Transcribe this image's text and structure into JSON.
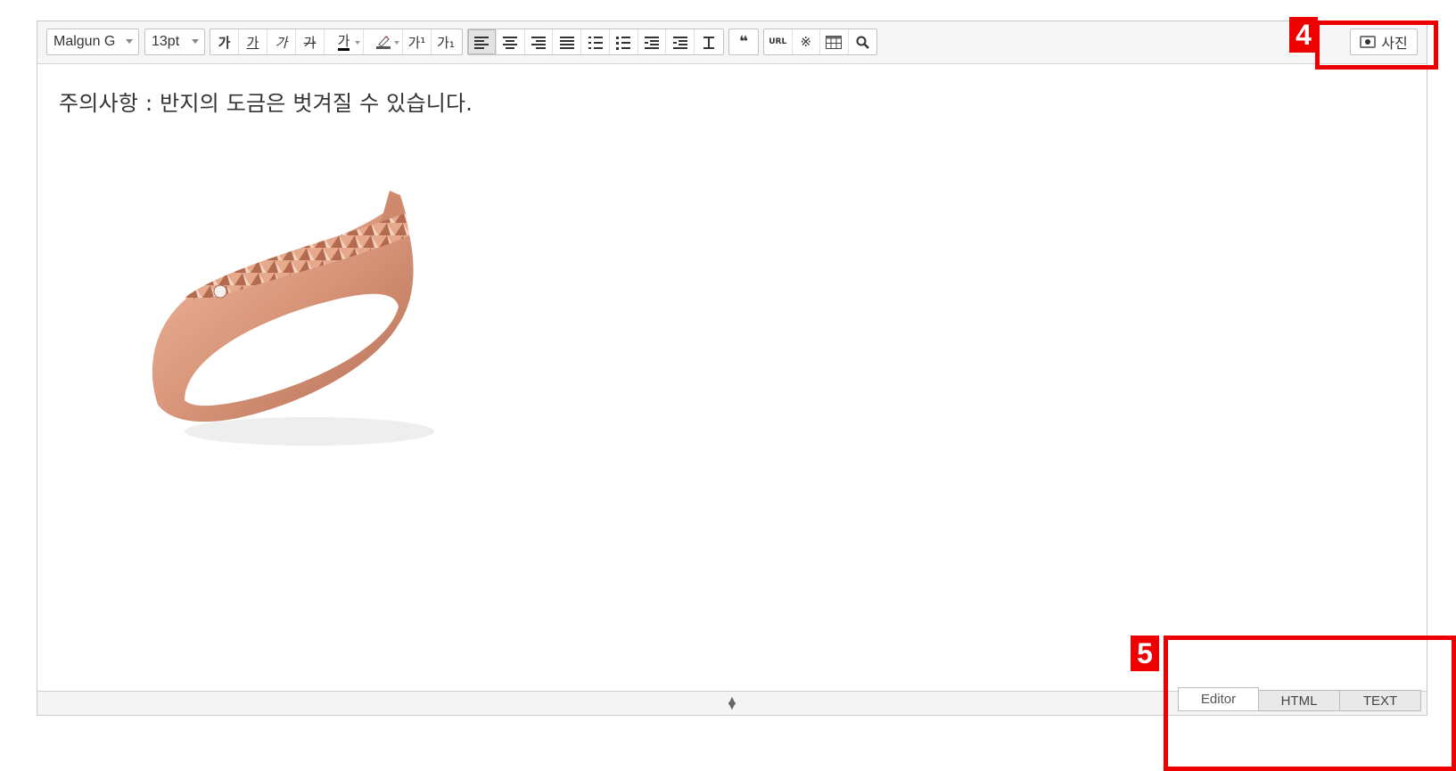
{
  "toolbar": {
    "font_family": "Malgun G",
    "font_size": "13pt",
    "format_buttons": [
      "가",
      "가",
      "가",
      "가",
      "가"
    ],
    "superscript": "가¹",
    "subscript": "가₁",
    "quote": "❝",
    "url": "URL",
    "special_char": "※",
    "photo_label": "사진"
  },
  "content": {
    "notice_text": "주의사항 : 반지의 도금은 벗겨질 수 있습니다."
  },
  "tabs": [
    "Editor",
    "HTML",
    "TEXT"
  ],
  "annotations": [
    "4",
    "5"
  ],
  "colors": {
    "annotation": "#ee0000",
    "ring": "#d9967a"
  }
}
